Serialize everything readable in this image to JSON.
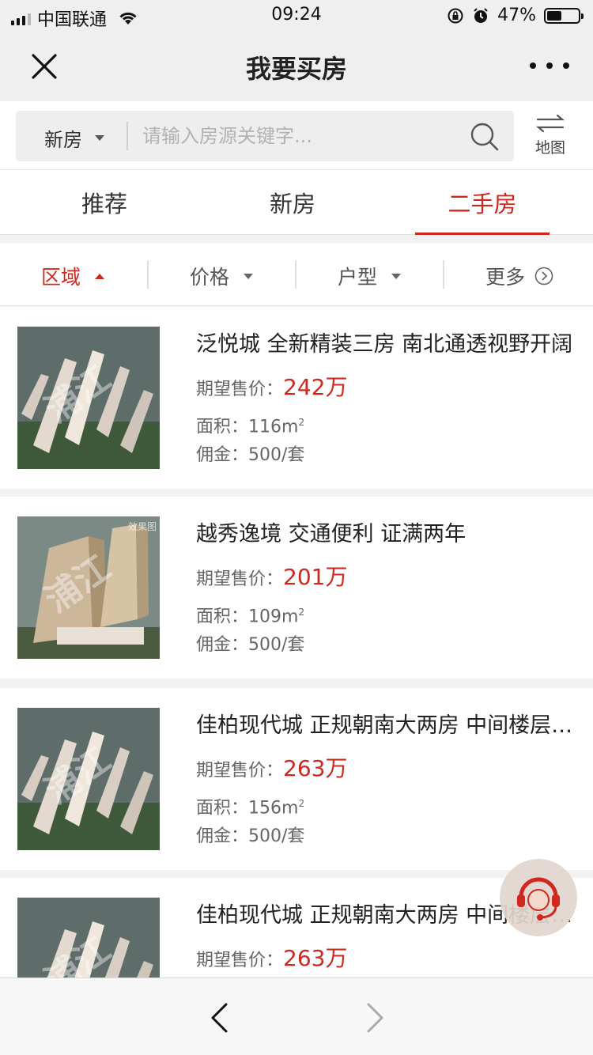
{
  "status_bar": {
    "carrier": "中国联通",
    "time": "09:24",
    "battery": "47%",
    "battery_level": 0.47
  },
  "navbar": {
    "title": "我要买房"
  },
  "search": {
    "type_label": "新房",
    "placeholder": "请输入房源关键字...",
    "map_label": "地图"
  },
  "tabs": [
    {
      "label": "推荐",
      "active": false
    },
    {
      "label": "新房",
      "active": false
    },
    {
      "label": "二手房",
      "active": true
    }
  ],
  "filters": [
    {
      "label": "区域",
      "active": true
    },
    {
      "label": "价格",
      "active": false
    },
    {
      "label": "户型",
      "active": false
    },
    {
      "label": "更多",
      "active": false
    }
  ],
  "listings": [
    {
      "title": "泛悦城 全新精装三房 南北通透视野开阔",
      "price_label": "期望售价：",
      "price": "242万",
      "area_label": "面积：",
      "area": "116m",
      "area_unit_sup": "2",
      "commission_label": "佣金：",
      "commission": "500/套",
      "watermark": "浦江"
    },
    {
      "title": "越秀逸境 交通便利 证满两年",
      "price_label": "期望售价：",
      "price": "201万",
      "area_label": "面积：",
      "area": "109m",
      "area_unit_sup": "2",
      "commission_label": "佣金：",
      "commission": "500/套",
      "watermark": "浦江",
      "image_tag": "效果图"
    },
    {
      "title": "佳柏现代城 正规朝南大两房 中间楼层采光好",
      "price_label": "期望售价：",
      "price": "263万",
      "area_label": "面积：",
      "area": "156m",
      "area_unit_sup": "2",
      "commission_label": "佣金：",
      "commission": "500/套",
      "watermark": "浦江"
    },
    {
      "title": "佳柏现代城 正规朝南大两房 中间楼层采光好",
      "price_label": "期望售价：",
      "price": "263万",
      "watermark": "浦江"
    }
  ],
  "icons": [
    "close-icon",
    "more-dots-icon",
    "search-icon",
    "map-switch-icon",
    "customer-service-icon",
    "back-arrow-icon",
    "forward-arrow-icon"
  ],
  "colors": {
    "accent": "#d0281f",
    "text": "#333333",
    "muted": "#666666"
  }
}
